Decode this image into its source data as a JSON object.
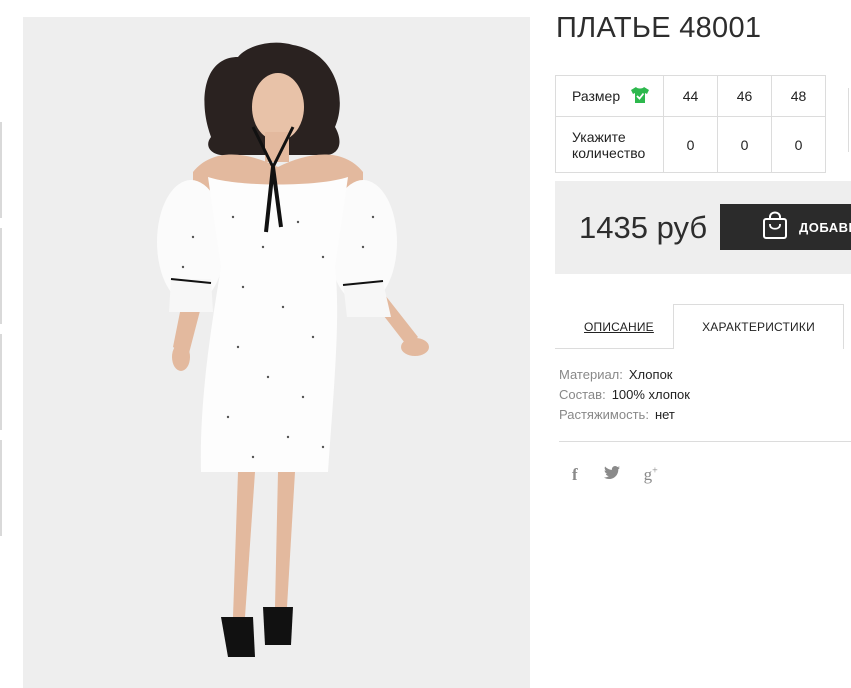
{
  "product": {
    "title": "ПЛАТЬЕ 48001",
    "image_alt": "Model in white off-shoulder dress with black neck tie"
  },
  "size_table": {
    "size_label": "Размер",
    "size_icon": "shirt-check-icon",
    "sizes": [
      "44",
      "46",
      "48"
    ],
    "qty_label": "Укажите количество",
    "quantities": [
      "0",
      "0",
      "0"
    ]
  },
  "purchase": {
    "price": "1435 руб",
    "cart_button_label": "ДОБАВИТЬ В КОРЗИНУ",
    "cart_icon": "shopping-bag-icon"
  },
  "tabs": [
    {
      "label": "ОПИСАНИЕ",
      "active": false
    },
    {
      "label": "ХАРАКТЕРИСТИКИ",
      "active": true
    }
  ],
  "characteristics": [
    {
      "key": "Материал:",
      "value": "Хлопок"
    },
    {
      "key": "Состав:",
      "value": "100% хлопок"
    },
    {
      "key": "Растяжимость:",
      "value": "нет"
    }
  ],
  "social": [
    "facebook-icon",
    "twitter-icon",
    "google-plus-icon"
  ],
  "colors": {
    "accent_green": "#2db84d",
    "button_dark": "#2b2b2b",
    "price_bg": "#eeeeee",
    "border": "#dcdcdc"
  }
}
